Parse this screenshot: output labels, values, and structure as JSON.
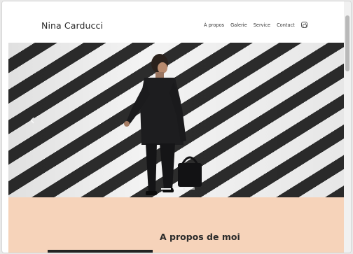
{
  "header": {
    "brand": "Nina Carducci",
    "nav": [
      {
        "label": "À propos"
      },
      {
        "label": "Galerie"
      },
      {
        "label": "Service"
      },
      {
        "label": "Contact"
      }
    ],
    "social_icon": "instagram-icon"
  },
  "hero": {
    "prev_icon": "chevron-left-icon",
    "prev_glyph": "‹",
    "slide_count": 3,
    "active_slide": 1
  },
  "about": {
    "title": "A propos de moi"
  },
  "colors": {
    "about_background": "#f6d3ba",
    "text": "#2a2a2a"
  }
}
